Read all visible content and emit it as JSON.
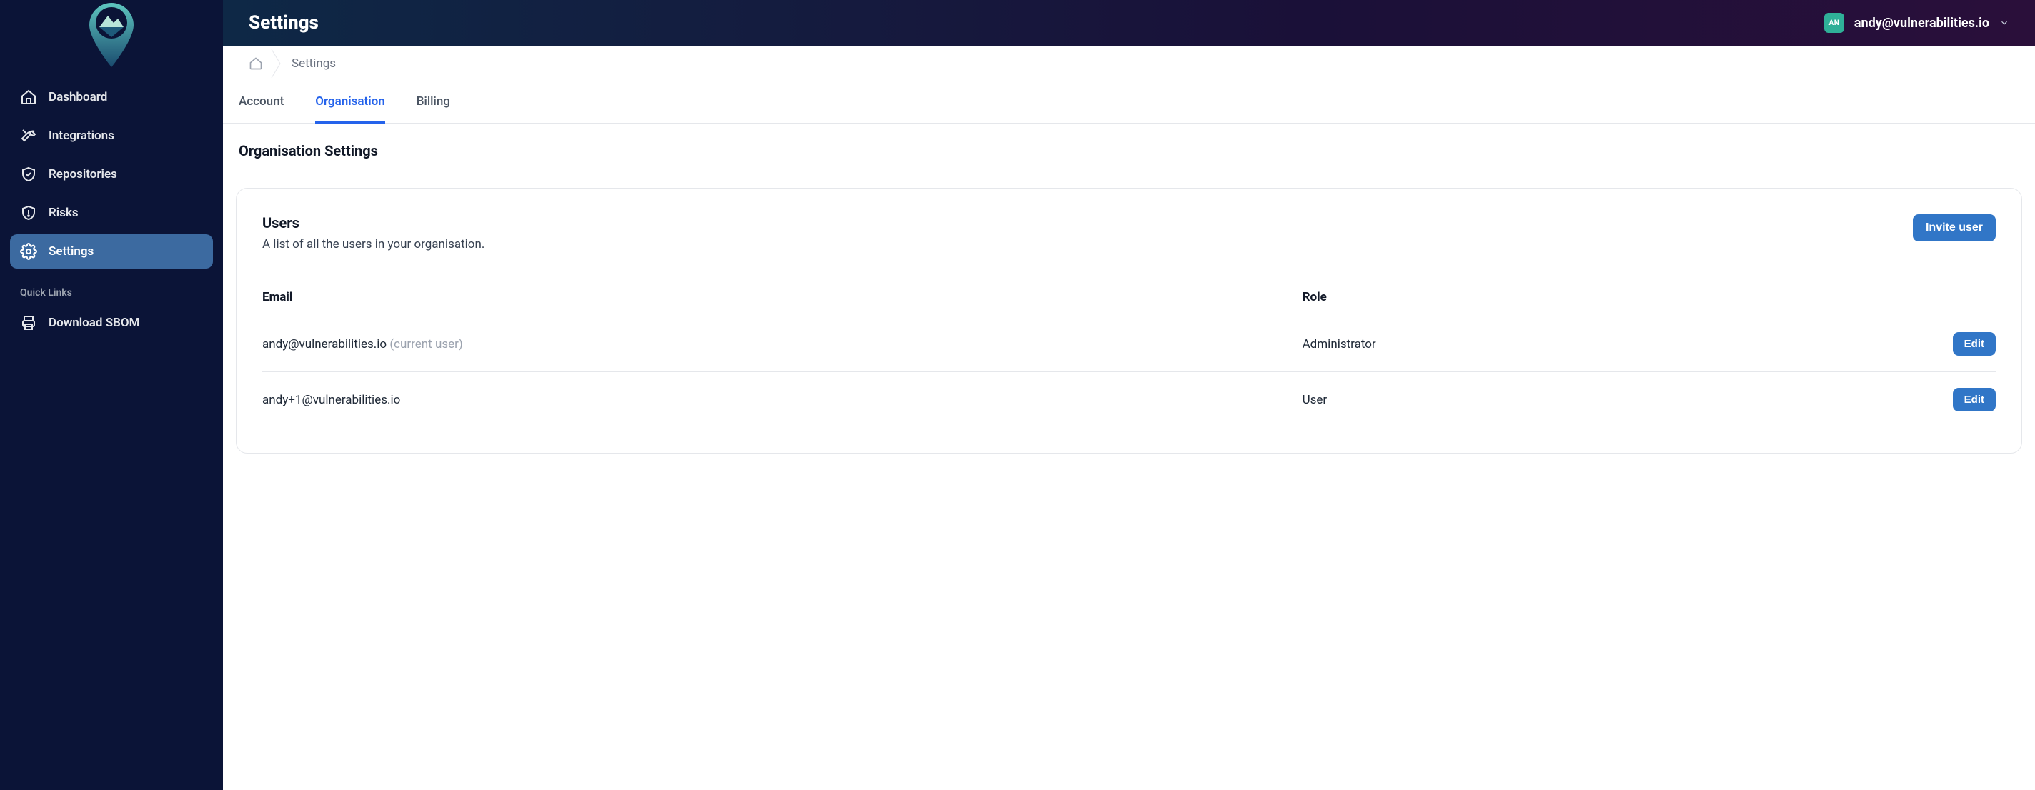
{
  "header": {
    "title": "Settings",
    "avatar_initials": "AN",
    "user_email": "andy@vulnerabilities.io"
  },
  "sidebar": {
    "items": [
      {
        "label": "Dashboard",
        "icon": "home-icon",
        "active": false
      },
      {
        "label": "Integrations",
        "icon": "tools-icon",
        "active": false
      },
      {
        "label": "Repositories",
        "icon": "shield-check-icon",
        "active": false
      },
      {
        "label": "Risks",
        "icon": "shield-alert-icon",
        "active": false
      },
      {
        "label": "Settings",
        "icon": "gear-icon",
        "active": true
      }
    ],
    "quick_links_label": "Quick Links",
    "quick_links": [
      {
        "label": "Download SBOM",
        "icon": "printer-icon"
      }
    ]
  },
  "breadcrumb": {
    "current": "Settings"
  },
  "tabs": [
    {
      "label": "Account",
      "active": false
    },
    {
      "label": "Organisation",
      "active": true
    },
    {
      "label": "Billing",
      "active": false
    }
  ],
  "page": {
    "heading": "Organisation Settings",
    "users_card": {
      "title": "Users",
      "subtitle": "A list of all the users in your organisation.",
      "invite_label": "Invite user",
      "columns": {
        "email": "Email",
        "role": "Role"
      },
      "edit_label": "Edit",
      "rows": [
        {
          "email": "andy@vulnerabilities.io",
          "suffix": "(current user)",
          "role": "Administrator"
        },
        {
          "email": "andy+1@vulnerabilities.io",
          "suffix": "",
          "role": "User"
        }
      ]
    }
  }
}
